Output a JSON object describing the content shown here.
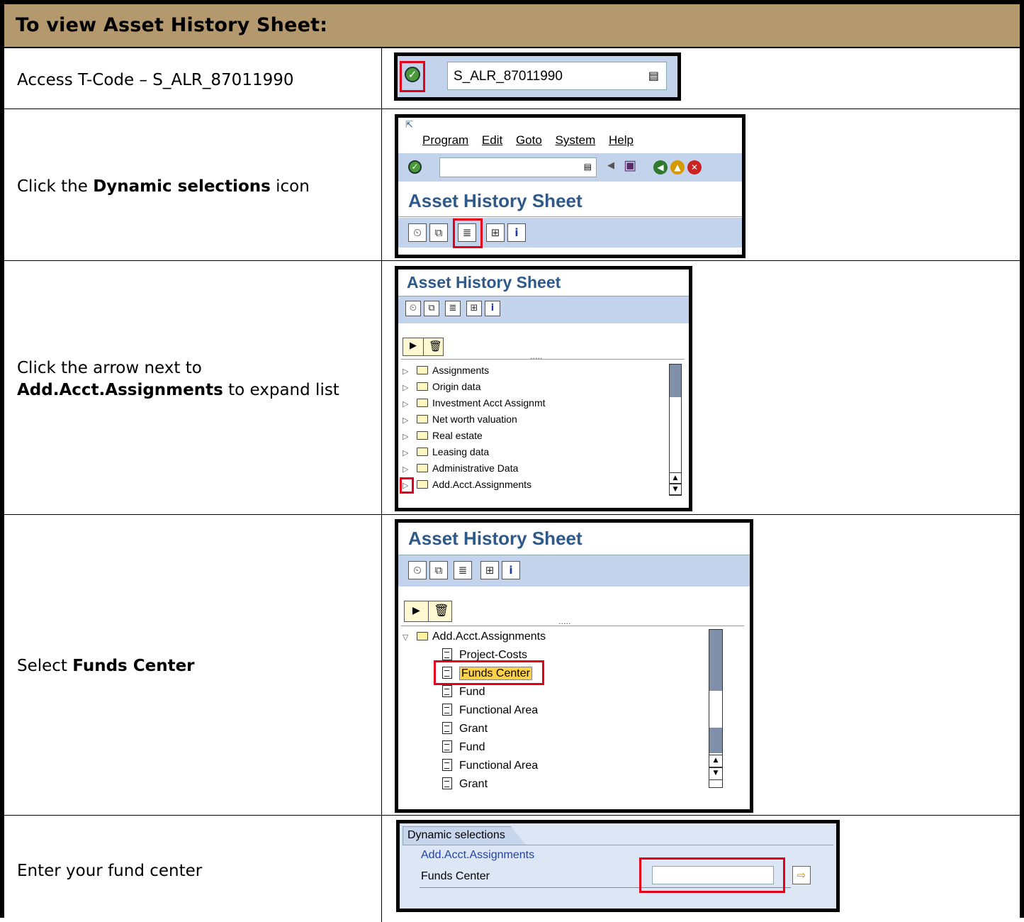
{
  "title": "To view Asset History Sheet:",
  "steps": [
    {
      "pre": "Access T-Code – S_ALR_87011990",
      "bold": "",
      "post": ""
    },
    {
      "pre": "Click the ",
      "bold": "Dynamic selections",
      "post": " icon"
    },
    {
      "pre": "Click the arrow next to ",
      "bold": "Add.Acct.Assignments",
      "post": " to expand list"
    },
    {
      "pre": "Select ",
      "bold": "Funds Center",
      "post": ""
    },
    {
      "pre": "Enter your fund center",
      "bold": "",
      "post": ""
    }
  ],
  "shot1": {
    "command_value": "S_ALR_87011990"
  },
  "shot2": {
    "menu": [
      "Program",
      "Edit",
      "Goto",
      "System",
      "Help"
    ],
    "screen_title": "Asset History Sheet"
  },
  "shot3": {
    "screen_title": "Asset History Sheet",
    "dots": ".....",
    "tree": [
      "Assignments",
      "Origin data",
      "Investment Acct Assignmt",
      "Net worth valuation",
      "Real estate",
      "Leasing data",
      "Administrative Data",
      "Add.Acct.Assignments"
    ]
  },
  "shot4": {
    "screen_title": "Asset History Sheet",
    "dots": ".....",
    "parent": "Add.Acct.Assignments",
    "children": [
      "Project-Costs",
      "Funds Center",
      "Fund",
      "Functional Area",
      "Grant",
      "Fund",
      "Functional Area",
      "Grant"
    ]
  },
  "shot5": {
    "tab": "Dynamic selections",
    "group": "Add.Acct.Assignments",
    "field_label": "Funds Center",
    "field_value": ""
  }
}
